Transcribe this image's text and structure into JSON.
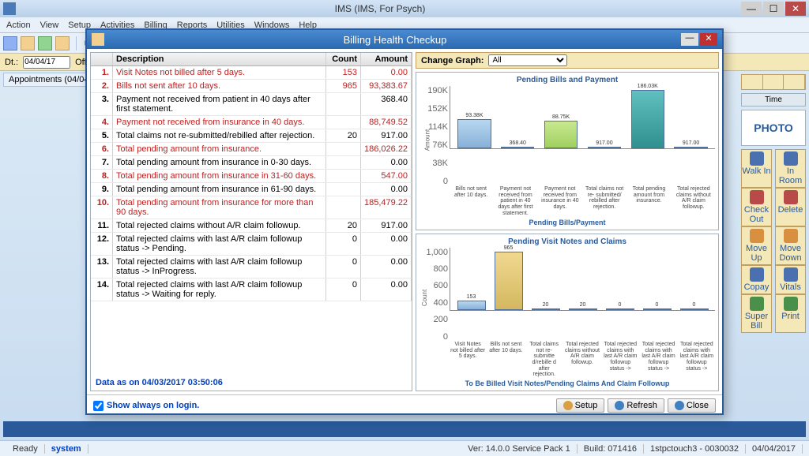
{
  "app": {
    "title": "IMS (IMS, For Psych)"
  },
  "menu": [
    "Action",
    "View",
    "Setup",
    "Activities",
    "Billing",
    "Reports",
    "Utilities",
    "Windows",
    "Help"
  ],
  "subbar": {
    "dt_label": "Dt.:",
    "date": "04/04/17",
    "office": "Offic"
  },
  "appointments_tab": "Appointments (04/04",
  "dialog": {
    "title": "Billing Health Checkup",
    "headers": {
      "desc": "Description",
      "count": "Count",
      "amount": "Amount"
    },
    "rows": [
      {
        "n": "1.",
        "desc": "Visit Notes not billed after 5 days.",
        "count": "153",
        "amount": "0.00",
        "red": true
      },
      {
        "n": "2.",
        "desc": "Bills not sent after 10 days.",
        "count": "965",
        "amount": "93,383.67",
        "red": true
      },
      {
        "n": "3.",
        "desc": "Payment not received from patient in 40 days after first statement.",
        "count": "",
        "amount": "368.40",
        "red": false
      },
      {
        "n": "4.",
        "desc": "Payment not received from insurance in 40 days.",
        "count": "",
        "amount": "88,749.52",
        "red": true
      },
      {
        "n": "5.",
        "desc": "Total claims not re-submitted/rebilled after rejection.",
        "count": "20",
        "amount": "917.00",
        "red": false
      },
      {
        "n": "6.",
        "desc": "Total pending amount from insurance.",
        "count": "",
        "amount": "186,026.22",
        "red": true
      },
      {
        "n": "7.",
        "desc": "Total pending amount from insurance in 0-30 days.",
        "count": "",
        "amount": "0.00",
        "red": false
      },
      {
        "n": "8.",
        "desc": "Total pending amount from insurance in 31-60 days.",
        "count": "",
        "amount": "547.00",
        "red": true
      },
      {
        "n": "9.",
        "desc": "Total pending amount from insurance in 61-90 days.",
        "count": "",
        "amount": "0.00",
        "red": false
      },
      {
        "n": "10.",
        "desc": "Total pending amount from insurance for more than 90 days.",
        "count": "",
        "amount": "185,479.22",
        "red": true
      },
      {
        "n": "11.",
        "desc": "Total rejected claims without A/R claim followup.",
        "count": "20",
        "amount": "917.00",
        "red": false
      },
      {
        "n": "12.",
        "desc": "Total rejected claims with last A/R claim followup status -> Pending.",
        "count": "0",
        "amount": "0.00",
        "red": false
      },
      {
        "n": "13.",
        "desc": "Total rejected claims with last A/R claim followup status -> InProgress.",
        "count": "0",
        "amount": "0.00",
        "red": false
      },
      {
        "n": "14.",
        "desc": "Total rejected claims with last A/R claim followup status -> Waiting for reply.",
        "count": "0",
        "amount": "0.00",
        "red": false
      }
    ],
    "data_as": "Data as on 04/03/2017 03:50:06",
    "show_always": "Show always on login.",
    "graph_label": "Change Graph:",
    "graph_value": "All",
    "btn_setup": "Setup",
    "btn_refresh": "Refresh",
    "btn_close": "Close"
  },
  "right": {
    "time": "Time",
    "photo": "PHOTO",
    "buttons": [
      [
        "Walk In",
        "In Room"
      ],
      [
        "Check Out",
        "Delete"
      ],
      [
        "Move Up",
        "Move Down"
      ],
      [
        "Copay",
        "Vitals"
      ],
      [
        "Super Bill",
        "Print"
      ]
    ]
  },
  "status": {
    "ready": "Ready",
    "system": "system",
    "ver": "Ver: 14.0.0 Service Pack 1",
    "build": "Build: 071416",
    "host": "1stpctouch3 - 0030032",
    "date": "04/04/2017"
  },
  "chart_data": [
    {
      "type": "bar",
      "title": "Pending Bills and Payment",
      "ylabel": "Amount",
      "yticks": [
        "190K",
        "152K",
        "114K",
        "76K",
        "38K",
        "0"
      ],
      "ylim": [
        0,
        190000
      ],
      "series": [
        {
          "label": "Bills not sent after 10 days.",
          "value": 93380,
          "disp": "93.38K",
          "cls": "c1"
        },
        {
          "label": "Payment not received from patient in 40 days after first statement.",
          "value": 368.4,
          "disp": "368.40",
          "cls": "c2"
        },
        {
          "label": "Payment not received from insurance in 40 days.",
          "value": 88750,
          "disp": "88.75K",
          "cls": "c3"
        },
        {
          "label": "Total claims not re- submitted/ rebilled after rejection.",
          "value": 917,
          "disp": "917.00",
          "cls": "c4"
        },
        {
          "label": "Total pending amount from insurance.",
          "value": 186030,
          "disp": "186.03K",
          "cls": "c5"
        },
        {
          "label": "Total rejected claims without A/R claim followup.",
          "value": 917,
          "disp": "917.00",
          "cls": "c6"
        }
      ],
      "footer": "Pending Bills/Payment"
    },
    {
      "type": "bar",
      "title": "Pending Visit Notes and Claims",
      "ylabel": "Count",
      "yticks": [
        "1,000",
        "800",
        "600",
        "400",
        "200",
        "0"
      ],
      "ylim": [
        0,
        1000
      ],
      "series": [
        {
          "label": "Visit Notes not billed after 5 days.",
          "value": 153,
          "disp": "153",
          "cls": "c1"
        },
        {
          "label": "Bills not sent after 10 days.",
          "value": 965,
          "disp": "965",
          "cls": "c2"
        },
        {
          "label": "Total claims not re- submitte d/rebille d after rejection.",
          "value": 20,
          "disp": "20",
          "cls": "c3"
        },
        {
          "label": "Total rejected claims without A/R claim followup.",
          "value": 20,
          "disp": "20",
          "cls": "c4"
        },
        {
          "label": "Total rejected claims with last A/R claim followup status ->",
          "value": 0,
          "disp": "0",
          "cls": "c5"
        },
        {
          "label": "Total rejected claims with last A/R claim followup status ->",
          "value": 0,
          "disp": "0",
          "cls": "c6"
        },
        {
          "label": "Total rejected claims with last A/R claim followup status ->",
          "value": 0,
          "disp": "0",
          "cls": "c7"
        }
      ],
      "footer": "To Be Billed Visit Notes/Pending Claims And Claim Followup"
    }
  ]
}
